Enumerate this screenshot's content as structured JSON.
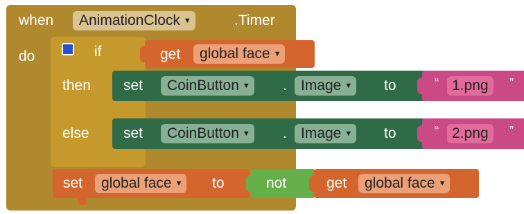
{
  "event": {
    "when": "when",
    "component": "AnimationClock",
    "event": ".Timer",
    "do": "do"
  },
  "ifblock": {
    "if": "if",
    "then": "then",
    "else": "else",
    "mutator_icon": "gear-icon"
  },
  "condition": {
    "get": "get",
    "variable": "global face"
  },
  "then_set": {
    "set": "set",
    "component": "CoinButton",
    "dot": ".",
    "property": "Image",
    "to": "to",
    "value": "1.png"
  },
  "else_set": {
    "set": "set",
    "component": "CoinButton",
    "dot": ".",
    "property": "Image",
    "to": "to",
    "value": "2.png"
  },
  "toggle": {
    "set": "set",
    "variable": "global face",
    "to": "to",
    "not": "not",
    "get": "get",
    "get_variable": "global face"
  },
  "quote_open": "“",
  "quote_close": "”",
  "colors": {
    "event": "#b0892f",
    "control": "#c5992c",
    "variable": "#d4662d",
    "component": "#2f6b46",
    "text": "#c94a85",
    "logic": "#66b04a"
  }
}
